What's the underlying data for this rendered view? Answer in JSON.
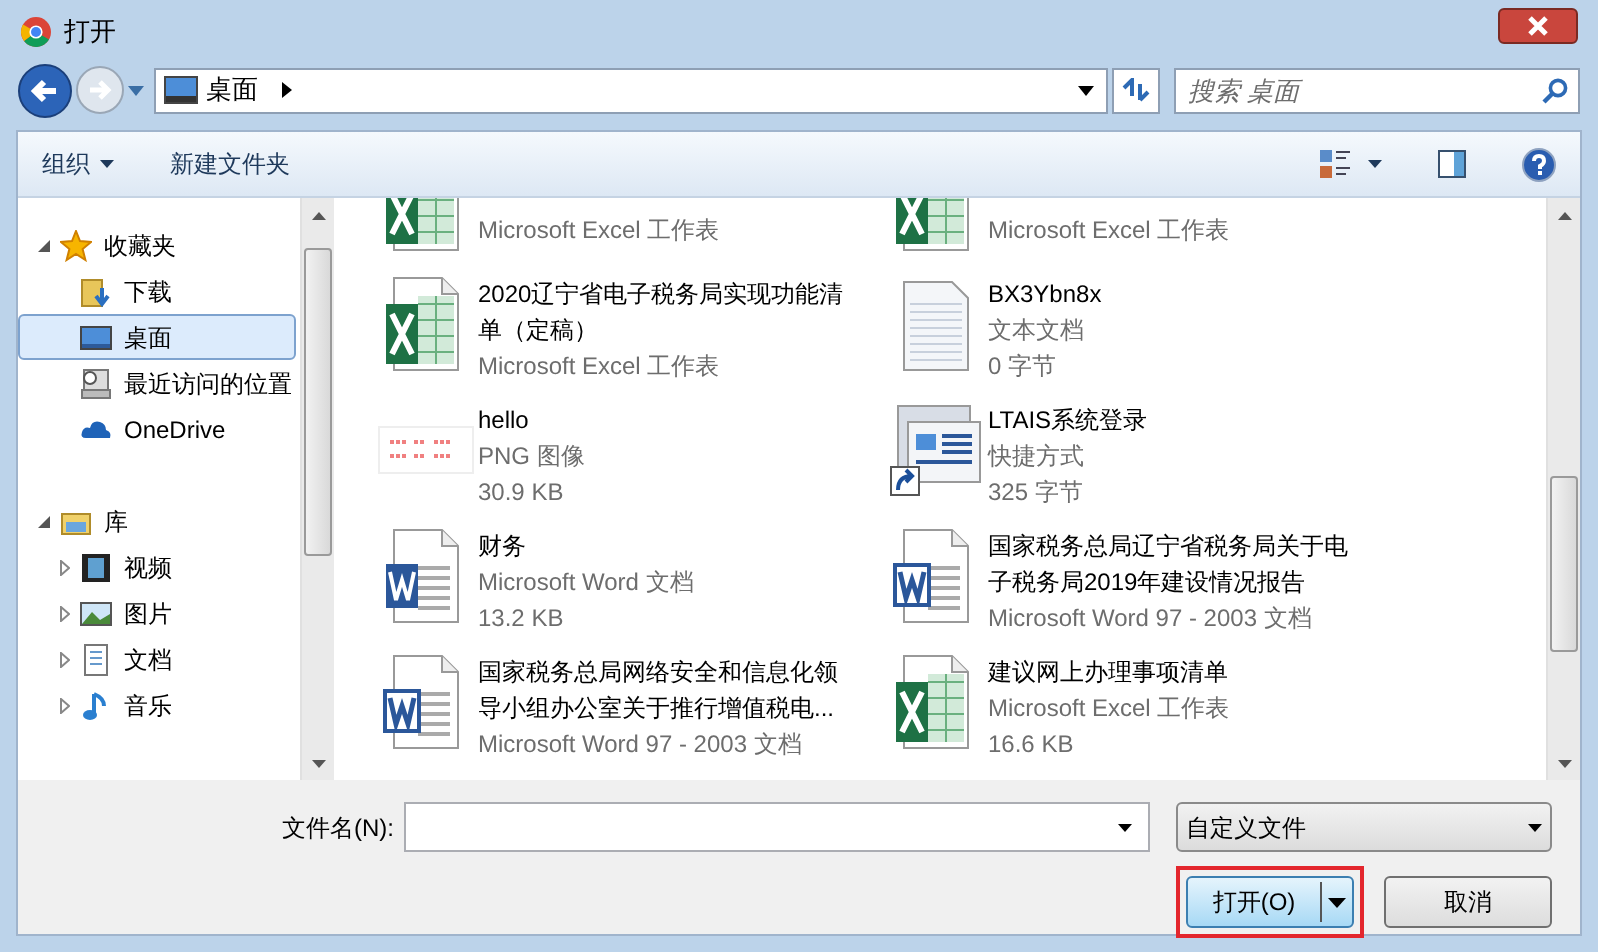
{
  "window": {
    "title": "打开"
  },
  "address": {
    "location": "桌面",
    "search_placeholder": "搜索 桌面"
  },
  "toolbar": {
    "organize": "组织",
    "new_folder": "新建文件夹"
  },
  "nav": [
    {
      "label": "收藏夹",
      "kind": "star",
      "expanded": true,
      "children": [
        {
          "label": "下载",
          "kind": "download",
          "selected": false
        },
        {
          "label": "桌面",
          "kind": "desktop",
          "selected": true
        },
        {
          "label": "最近访问的位置",
          "kind": "recent",
          "selected": false
        },
        {
          "label": "OneDrive",
          "kind": "cloud",
          "selected": false
        }
      ]
    },
    {
      "label": "库",
      "kind": "library",
      "expanded": true,
      "children": [
        {
          "label": "视频",
          "kind": "video",
          "selected": false,
          "expanded": false
        },
        {
          "label": "图片",
          "kind": "picture",
          "selected": false,
          "expanded": false
        },
        {
          "label": "文档",
          "kind": "document",
          "selected": false,
          "expanded": false
        },
        {
          "label": "音乐",
          "kind": "music",
          "selected": false,
          "expanded": false
        }
      ]
    }
  ],
  "files": [
    {
      "kind": "excel",
      "lines": [
        "Microsoft Excel 工作表"
      ],
      "partial": true
    },
    {
      "kind": "excel",
      "lines": [
        "Microsoft Excel 工作表"
      ],
      "partial": true
    },
    {
      "kind": "excel",
      "name": "2020辽宁省电子税务局实现功能清单（定稿）",
      "lines": [
        "Microsoft Excel 工作表"
      ]
    },
    {
      "kind": "text",
      "name": "BX3Ybn8x",
      "lines": [
        "文本文档",
        "0 字节"
      ]
    },
    {
      "kind": "image",
      "name": "hello",
      "lines": [
        "PNG 图像",
        "30.9 KB"
      ]
    },
    {
      "kind": "shortcut",
      "name": "LTAIS系统登录",
      "lines": [
        "快捷方式",
        "325 字节"
      ]
    },
    {
      "kind": "word",
      "name": "财务",
      "lines": [
        "Microsoft Word 文档",
        "13.2 KB"
      ]
    },
    {
      "kind": "word97",
      "name": "国家税务总局辽宁省税务局关于电子税务局2019年建设情况报告",
      "lines": [
        "Microsoft Word 97 - 2003 文档"
      ]
    },
    {
      "kind": "word97",
      "name": "国家税务总局网络安全和信息化领导小组办公室关于推行增值税电...",
      "lines": [
        "Microsoft Word 97 - 2003 文档"
      ]
    },
    {
      "kind": "excel",
      "name": "建议网上办理事项清单",
      "lines": [
        "Microsoft Excel 工作表",
        "16.6 KB"
      ]
    }
  ],
  "filename": {
    "label": "文件名(N):"
  },
  "filter": "自定义文件",
  "buttons": {
    "open": "打开(O)",
    "cancel": "取消"
  }
}
